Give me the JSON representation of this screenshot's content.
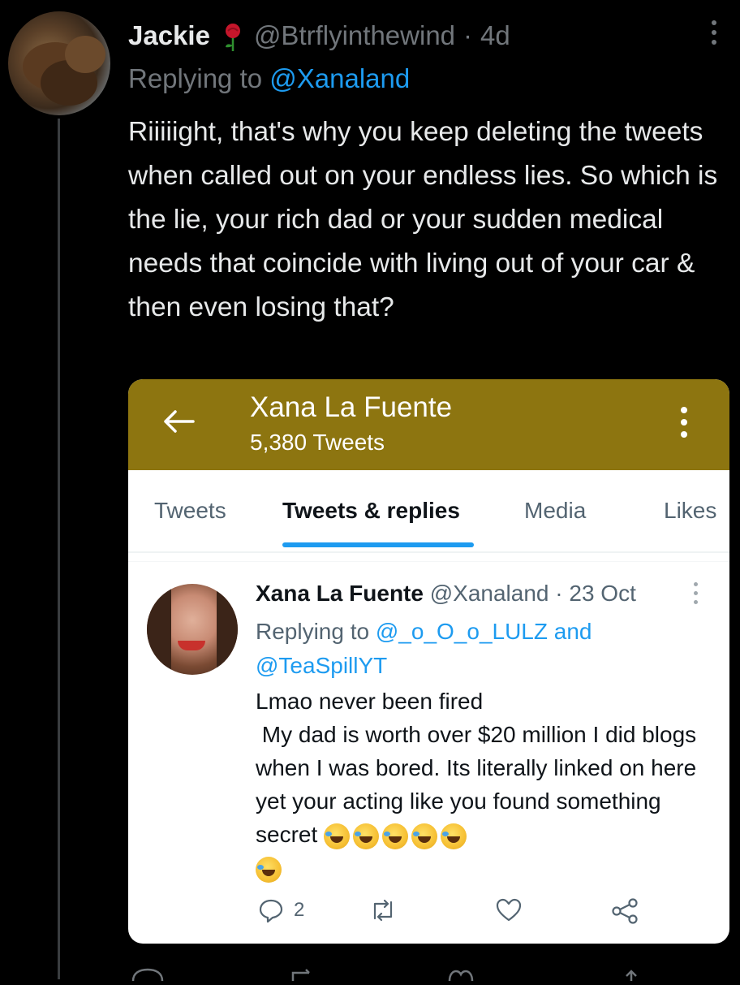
{
  "tweet": {
    "author_name": "Jackie",
    "author_emoji": "rose-icon",
    "handle": "@Btrflyinthewind",
    "separator": "·",
    "time": "4d",
    "replying_prefix": "Replying to",
    "replying_mention": "@Xanaland",
    "text": "Riiiiight, that's why you keep deleting the tweets when called out on your endless lies.  So which is the lie, your rich dad or your sudden medical needs that coincide with living out of your car & then even losing that?"
  },
  "card": {
    "header_title": "Xana La Fuente",
    "header_subtitle": "5,380 Tweets",
    "tabs": [
      "Tweets",
      "Tweets & replies",
      "Media",
      "Likes"
    ],
    "active_tab": "Tweets & replies",
    "inner_tweet": {
      "name": "Xana La Fuente",
      "handle": "@Xanaland",
      "separator": "·",
      "date": "23 Oct",
      "replying_prefix": "Replying to",
      "mention_1": "@_o_O_o_LULZ",
      "and": "and",
      "mention_2": "@TeaSpillYT",
      "text_line_1": "Lmao never been fired",
      "text_body": " My dad is worth over $20 million I did blogs when I was bored. Its literally linked on here yet your acting like you found something secret",
      "reply_count": "2"
    },
    "header_color": "#8d7510",
    "accent_color": "#1d9bf0"
  }
}
